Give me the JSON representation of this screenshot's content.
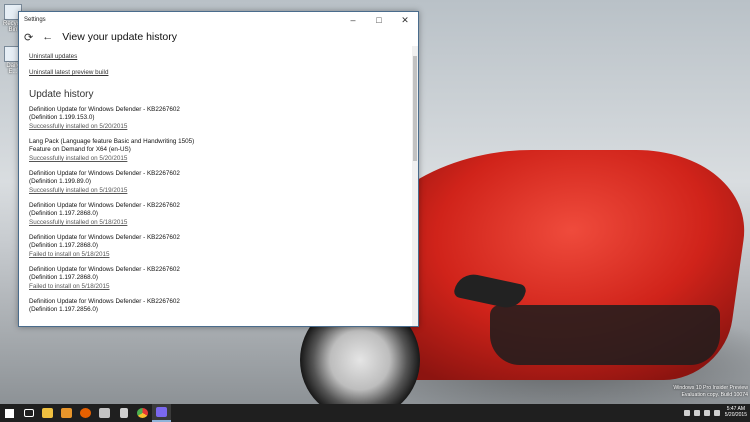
{
  "window": {
    "title": "Settings",
    "minimize_icon": "minimize-icon",
    "maximize_icon": "maximize-icon",
    "close_icon": "close-icon",
    "minimize_glyph": "–",
    "maximize_glyph": "□",
    "close_glyph": "✕"
  },
  "header": {
    "page_title": "View your update history",
    "refresh_glyph": "⟳",
    "back_glyph": "←"
  },
  "links": {
    "uninstall_updates": "Uninstall updates",
    "uninstall_preview": "Uninstall latest preview build"
  },
  "history": {
    "title": "Update history",
    "items": [
      {
        "title": "Definition Update for Windows Defender - KB2267602 (Definition 1.199.153.0)",
        "status": "Successfully installed on 5/20/2015"
      },
      {
        "title": "Lang Pack (Language feature Basic and Handwriting 1505) Feature on Demand for X64 (en-US)",
        "status": "Successfully installed on 5/20/2015"
      },
      {
        "title": "Definition Update for Windows Defender - KB2267602 (Definition 1.199.89.0)",
        "status": "Successfully installed on 5/19/2015"
      },
      {
        "title": "Definition Update for Windows Defender - KB2267602 (Definition 1.197.2868.0)",
        "status": "Successfully installed on 5/18/2015"
      },
      {
        "title": "Definition Update for Windows Defender - KB2267602 (Definition 1.197.2868.0)",
        "status": "Failed to install on 5/18/2015"
      },
      {
        "title": "Definition Update for Windows Defender - KB2267602 (Definition 1.197.2868.0)",
        "status": "Failed to install on 5/18/2015"
      },
      {
        "title": "Definition Update for Windows Defender - KB2267602 (Definition 1.197.2856.0)",
        "status": ""
      }
    ]
  },
  "desktop": {
    "icons": [
      {
        "label": "Recycle Bin"
      },
      {
        "label": "Daily E..."
      }
    ]
  },
  "taskbar": {
    "items": [
      "start-icon",
      "task-view-icon",
      "file-explorer-icon",
      "store-icon",
      "firefox-icon",
      "edge-icon",
      "document-icon",
      "chrome-icon",
      "settings-icon"
    ],
    "colors": {
      "start": "#ffffff",
      "task_view": "#ffffff",
      "file_explorer": "#f0c040",
      "store": "#e8952b",
      "firefox": "#e66000",
      "edge": "#c2c2c2",
      "document": "#d0d0d0",
      "chrome": "#4caf50",
      "settings": "#7b68ee"
    }
  },
  "watermark": {
    "line1": "Windows 10 Pro Insider Preview",
    "line2": "Evaluation copy. Build 10074"
  },
  "clock": {
    "time": "5:47 AM",
    "date": "5/20/2015"
  }
}
